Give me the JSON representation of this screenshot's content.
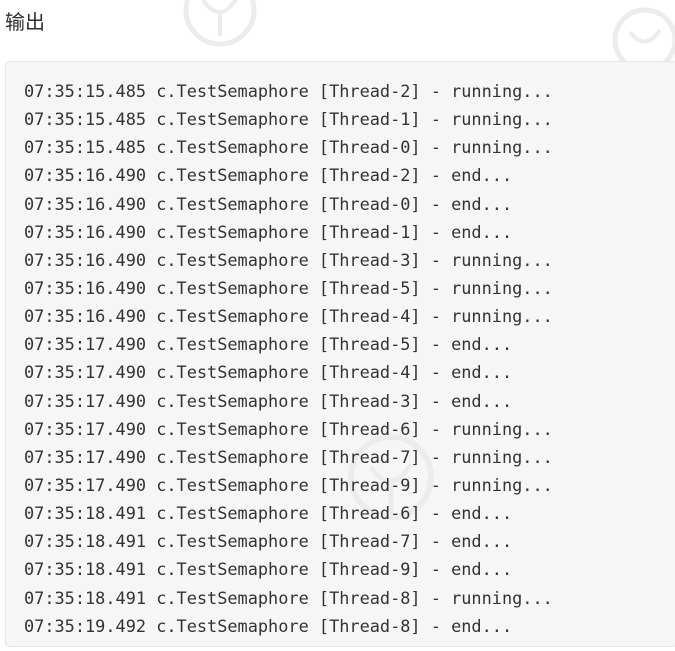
{
  "heading": "输出",
  "output_lines": [
    "07:35:15.485 c.TestSemaphore [Thread-2] - running...",
    "07:35:15.485 c.TestSemaphore [Thread-1] - running...",
    "07:35:15.485 c.TestSemaphore [Thread-0] - running...",
    "07:35:16.490 c.TestSemaphore [Thread-2] - end...",
    "07:35:16.490 c.TestSemaphore [Thread-0] - end...",
    "07:35:16.490 c.TestSemaphore [Thread-1] - end...",
    "07:35:16.490 c.TestSemaphore [Thread-3] - running...",
    "07:35:16.490 c.TestSemaphore [Thread-5] - running...",
    "07:35:16.490 c.TestSemaphore [Thread-4] - running...",
    "07:35:17.490 c.TestSemaphore [Thread-5] - end...",
    "07:35:17.490 c.TestSemaphore [Thread-4] - end...",
    "07:35:17.490 c.TestSemaphore [Thread-3] - end...",
    "07:35:17.490 c.TestSemaphore [Thread-6] - running...",
    "07:35:17.490 c.TestSemaphore [Thread-7] - running...",
    "07:35:17.490 c.TestSemaphore [Thread-9] - running...",
    "07:35:18.491 c.TestSemaphore [Thread-6] - end...",
    "07:35:18.491 c.TestSemaphore [Thread-7] - end...",
    "07:35:18.491 c.TestSemaphore [Thread-9] - end...",
    "07:35:18.491 c.TestSemaphore [Thread-8] - running...",
    "07:35:19.492 c.TestSemaphore [Thread-8] - end..."
  ],
  "colors": {
    "code_background": "#f6f6f6",
    "code_border": "#e7e7e7",
    "code_text": "#333333",
    "heading_text": "#2f2f2f",
    "watermark": "#ececec"
  }
}
